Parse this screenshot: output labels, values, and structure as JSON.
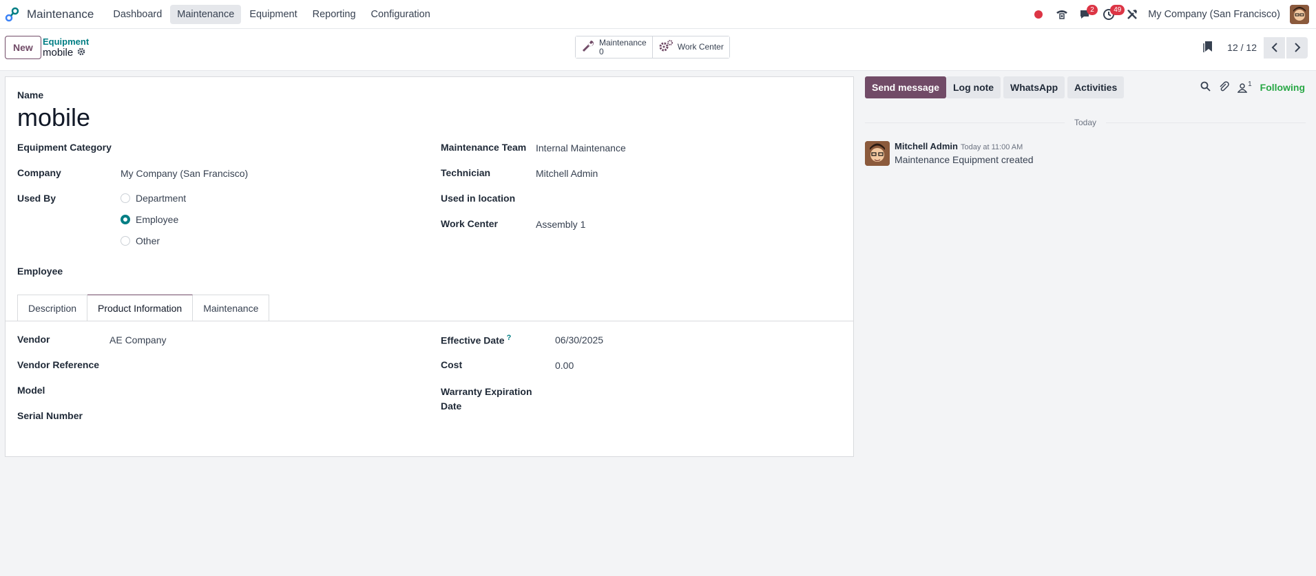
{
  "navbar": {
    "app_name": "Maintenance",
    "menu": [
      "Dashboard",
      "Maintenance",
      "Equipment",
      "Reporting",
      "Configuration"
    ],
    "active_menu": "Maintenance",
    "chat_badge": "2",
    "activity_badge": "49",
    "company": "My Company (San Francisco)"
  },
  "control": {
    "new_label": "New",
    "breadcrumb_parent": "Equipment",
    "breadcrumb_current": "mobile",
    "smart_maintenance_label": "Maintenance",
    "smart_maintenance_count": "0",
    "smart_workcenter_label": "Work Center",
    "pager": "12 / 12"
  },
  "form": {
    "name_label": "Name",
    "name_value": "mobile",
    "equipment_category_label": "Equipment Category",
    "company_label": "Company",
    "company_value": "My Company (San Francisco)",
    "used_by_label": "Used By",
    "used_by_options": [
      "Department",
      "Employee",
      "Other"
    ],
    "used_by_selected": "Employee",
    "employee_label": "Employee",
    "maintenance_team_label": "Maintenance Team",
    "maintenance_team_value": "Internal Maintenance",
    "technician_label": "Technician",
    "technician_value": "Mitchell Admin",
    "used_in_location_label": "Used in location",
    "work_center_label": "Work Center",
    "work_center_value": "Assembly 1",
    "tabs": [
      "Description",
      "Product Information",
      "Maintenance"
    ],
    "active_tab": "Product Information",
    "vendor_label": "Vendor",
    "vendor_value": "AE Company",
    "vendor_reference_label": "Vendor Reference",
    "model_label": "Model",
    "serial_number_label": "Serial Number",
    "effective_date_label": "Effective Date",
    "effective_date_help": "?",
    "effective_date_value": "06/30/2025",
    "cost_label": "Cost",
    "cost_value": "0.00",
    "warranty_label_line1": "Warranty Expiration",
    "warranty_label_line2": "Date"
  },
  "chatter": {
    "send_message": "Send message",
    "log_note": "Log note",
    "whatsapp": "WhatsApp",
    "activities": "Activities",
    "follower_count": "1",
    "following": "Following",
    "day": "Today",
    "message": {
      "author": "Mitchell Admin",
      "time": "Today at 11:00 AM",
      "text": "Maintenance Equipment created"
    }
  },
  "colors": {
    "primary": "#714b67",
    "accent": "#017e84",
    "following": "#28a745",
    "badge": "#dc3545"
  }
}
